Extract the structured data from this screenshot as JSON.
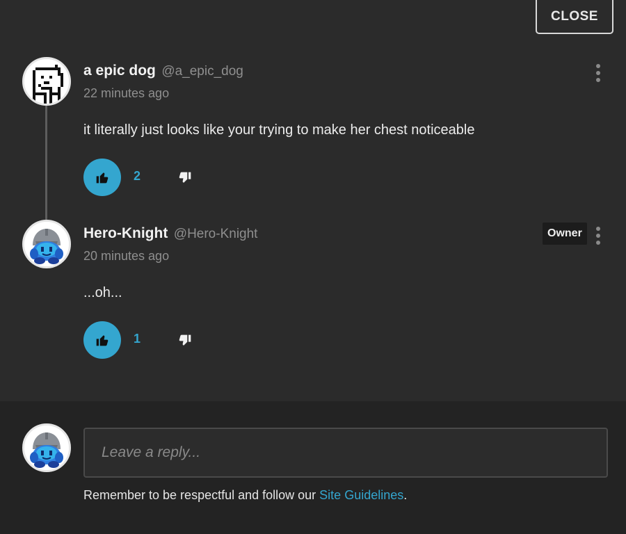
{
  "close_label": "CLOSE",
  "comments": [
    {
      "author_name": "a epic dog",
      "author_handle": "@a_epic_dog",
      "timestamp": "22 minutes ago",
      "text": "it literally just looks like your trying to make her chest noticeable",
      "likes": "2",
      "badge": ""
    },
    {
      "author_name": "Hero-Knight",
      "author_handle": "@Hero-Knight",
      "timestamp": "20 minutes ago",
      "text": "...oh...",
      "likes": "1",
      "badge": "Owner"
    }
  ],
  "reply": {
    "placeholder": "Leave a reply...",
    "value": ""
  },
  "guidelines": {
    "prefix": "Remember to be respectful and follow our ",
    "link_text": "Site Guidelines",
    "suffix": "."
  },
  "colors": {
    "accent": "#34a6cf",
    "background": "#2b2b2b",
    "footer_background": "#232323",
    "muted_text": "#8f8f8f"
  },
  "icons": {
    "like": "thumbs-up-icon",
    "dislike": "thumbs-down-icon",
    "menu": "kebab-menu-icon"
  }
}
